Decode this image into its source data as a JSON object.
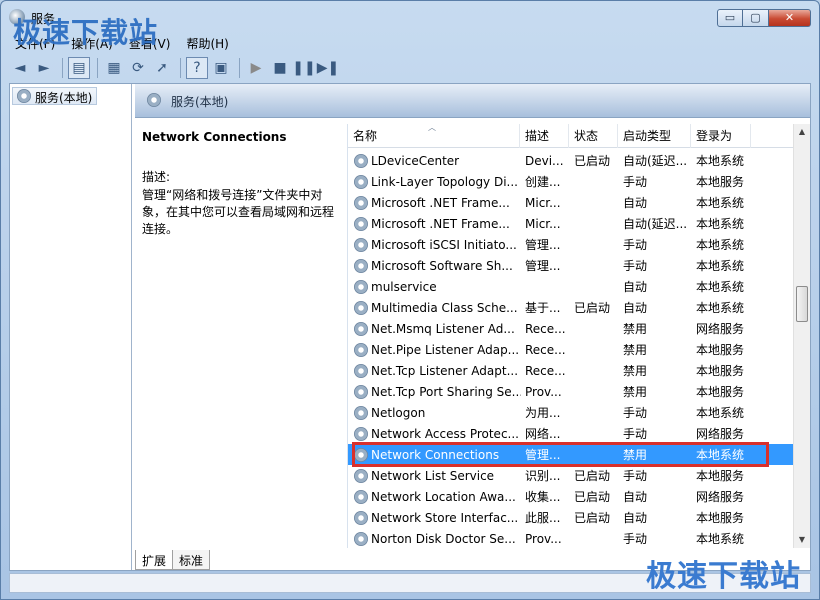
{
  "window": {
    "title": "服务",
    "minimize": "▭",
    "maximize": "▢",
    "close": "✕"
  },
  "watermark": {
    "text": "极速下载站"
  },
  "menu": [
    "文件(F)",
    "操作(A)",
    "查看(V)",
    "帮助(H)"
  ],
  "toolbar": {
    "back": "◄",
    "forward": "►",
    "console": "▤",
    "properties": "▦",
    "refresh": "⟳",
    "export": "➚",
    "help": "?",
    "view": "▣",
    "start": "▶",
    "stop": "■",
    "pause": "❚❚",
    "restart": "▶❚"
  },
  "tree": {
    "root_label": "服务(本地)"
  },
  "pane": {
    "header_title": "服务(本地)"
  },
  "detail": {
    "service_name": "Network Connections",
    "desc_label": "描述:",
    "desc_text": "管理“网络和拨号连接”文件夹中对象，在其中您可以查看局域网和远程连接。"
  },
  "columns": {
    "name": "名称",
    "desc": "描述",
    "status": "状态",
    "startup": "启动类型",
    "logon": "登录为"
  },
  "services": [
    {
      "name": "LDeviceCenter",
      "desc": "Devi...",
      "status": "已启动",
      "startup": "自动(延迟...",
      "logon": "本地系统"
    },
    {
      "name": "Link-Layer Topology Di...",
      "desc": "创建...",
      "status": "",
      "startup": "手动",
      "logon": "本地服务"
    },
    {
      "name": "Microsoft .NET Frame...",
      "desc": "Micr...",
      "status": "",
      "startup": "自动",
      "logon": "本地系统"
    },
    {
      "name": "Microsoft .NET Frame...",
      "desc": "Micr...",
      "status": "",
      "startup": "自动(延迟...",
      "logon": "本地系统"
    },
    {
      "name": "Microsoft iSCSI Initiato...",
      "desc": "管理...",
      "status": "",
      "startup": "手动",
      "logon": "本地系统"
    },
    {
      "name": "Microsoft Software Sh...",
      "desc": "管理...",
      "status": "",
      "startup": "手动",
      "logon": "本地系统"
    },
    {
      "name": "mulservice",
      "desc": "",
      "status": "",
      "startup": "自动",
      "logon": "本地系统"
    },
    {
      "name": "Multimedia Class Sche...",
      "desc": "基于...",
      "status": "已启动",
      "startup": "自动",
      "logon": "本地系统"
    },
    {
      "name": "Net.Msmq Listener Ad...",
      "desc": "Rece...",
      "status": "",
      "startup": "禁用",
      "logon": "网络服务"
    },
    {
      "name": "Net.Pipe Listener Adap...",
      "desc": "Rece...",
      "status": "",
      "startup": "禁用",
      "logon": "本地服务"
    },
    {
      "name": "Net.Tcp Listener Adapt...",
      "desc": "Rece...",
      "status": "",
      "startup": "禁用",
      "logon": "本地服务"
    },
    {
      "name": "Net.Tcp Port Sharing Se...",
      "desc": "Prov...",
      "status": "",
      "startup": "禁用",
      "logon": "本地服务"
    },
    {
      "name": "Netlogon",
      "desc": "为用...",
      "status": "",
      "startup": "手动",
      "logon": "本地系统"
    },
    {
      "name": "Network Access Protec...",
      "desc": "网络...",
      "status": "",
      "startup": "手动",
      "logon": "网络服务"
    },
    {
      "name": "Network Connections",
      "desc": "管理...",
      "status": "",
      "startup": "禁用",
      "logon": "本地系统"
    },
    {
      "name": "Network List Service",
      "desc": "识别...",
      "status": "已启动",
      "startup": "手动",
      "logon": "本地服务"
    },
    {
      "name": "Network Location Awa...",
      "desc": "收集...",
      "status": "已启动",
      "startup": "自动",
      "logon": "网络服务"
    },
    {
      "name": "Network Store Interfac...",
      "desc": "此服...",
      "status": "已启动",
      "startup": "自动",
      "logon": "本地服务"
    },
    {
      "name": "Norton Disk Doctor Se...",
      "desc": "Prov...",
      "status": "",
      "startup": "手动",
      "logon": "本地系统"
    }
  ],
  "selected_row": 14,
  "tabs": [
    "扩展",
    "标准"
  ],
  "scroll": {
    "up": "▲",
    "down": "▼"
  }
}
